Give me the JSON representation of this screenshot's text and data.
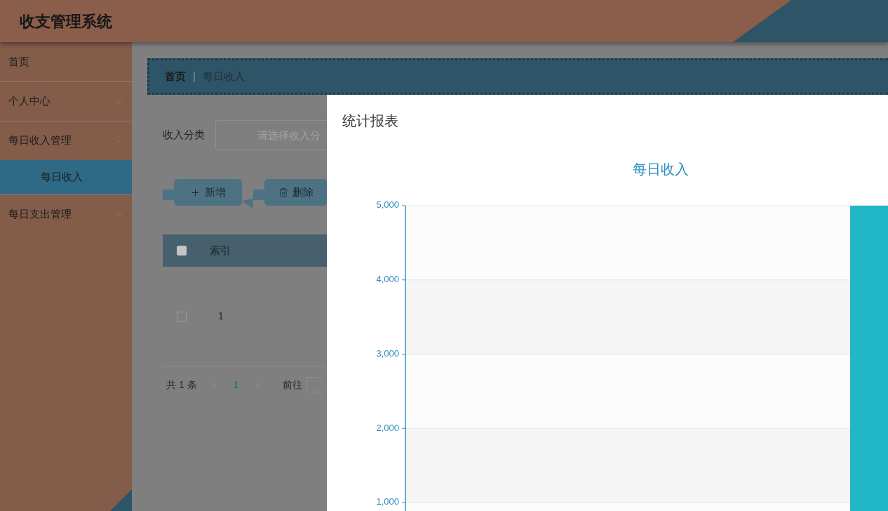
{
  "header": {
    "title": "收支管理系统"
  },
  "sidebar": {
    "items": [
      {
        "kind": "link",
        "label": "首页",
        "selected": false
      },
      {
        "kind": "group",
        "label": "个人中心",
        "selected": false
      },
      {
        "kind": "group",
        "label": "每日收入管理",
        "selected": false,
        "children": [
          {
            "kind": "link",
            "label": "每日收入",
            "selected": true
          }
        ]
      },
      {
        "kind": "group",
        "label": "每日支出管理",
        "selected": false
      }
    ]
  },
  "breadcrumb": {
    "items": [
      "首页",
      "每日收入"
    ],
    "separator": "|"
  },
  "search": {
    "label": "收入分类",
    "placeholder": "请选择收入分"
  },
  "toolbar": {
    "buttons": [
      {
        "kind": "add",
        "label": "新增"
      },
      {
        "kind": "delete",
        "label": "删除"
      }
    ]
  },
  "table": {
    "select_all": {
      "checked": false
    },
    "columns": [
      {
        "label": "索引"
      }
    ],
    "rows": [
      {
        "checked": false,
        "cells": [
          "1"
        ]
      }
    ]
  },
  "pagination": {
    "total": "共 1 条",
    "pages": [
      {
        "label": "1",
        "selected": true
      }
    ],
    "goto_label": "前往"
  },
  "dialog": {
    "title": "统计报表",
    "chart_data": {
      "type": "bar",
      "title": "每日收入",
      "values": [
        5000
      ],
      "ylim": [
        0,
        5000
      ],
      "grid": true,
      "yticks": [
        {
          "value": 1000,
          "label": "1,000"
        },
        {
          "value": 2000,
          "label": "2,000"
        },
        {
          "value": 3000,
          "label": "3,000"
        },
        {
          "value": 4000,
          "label": "4,000"
        },
        {
          "value": 5000,
          "label": "5,000"
        }
      ]
    }
  }
}
